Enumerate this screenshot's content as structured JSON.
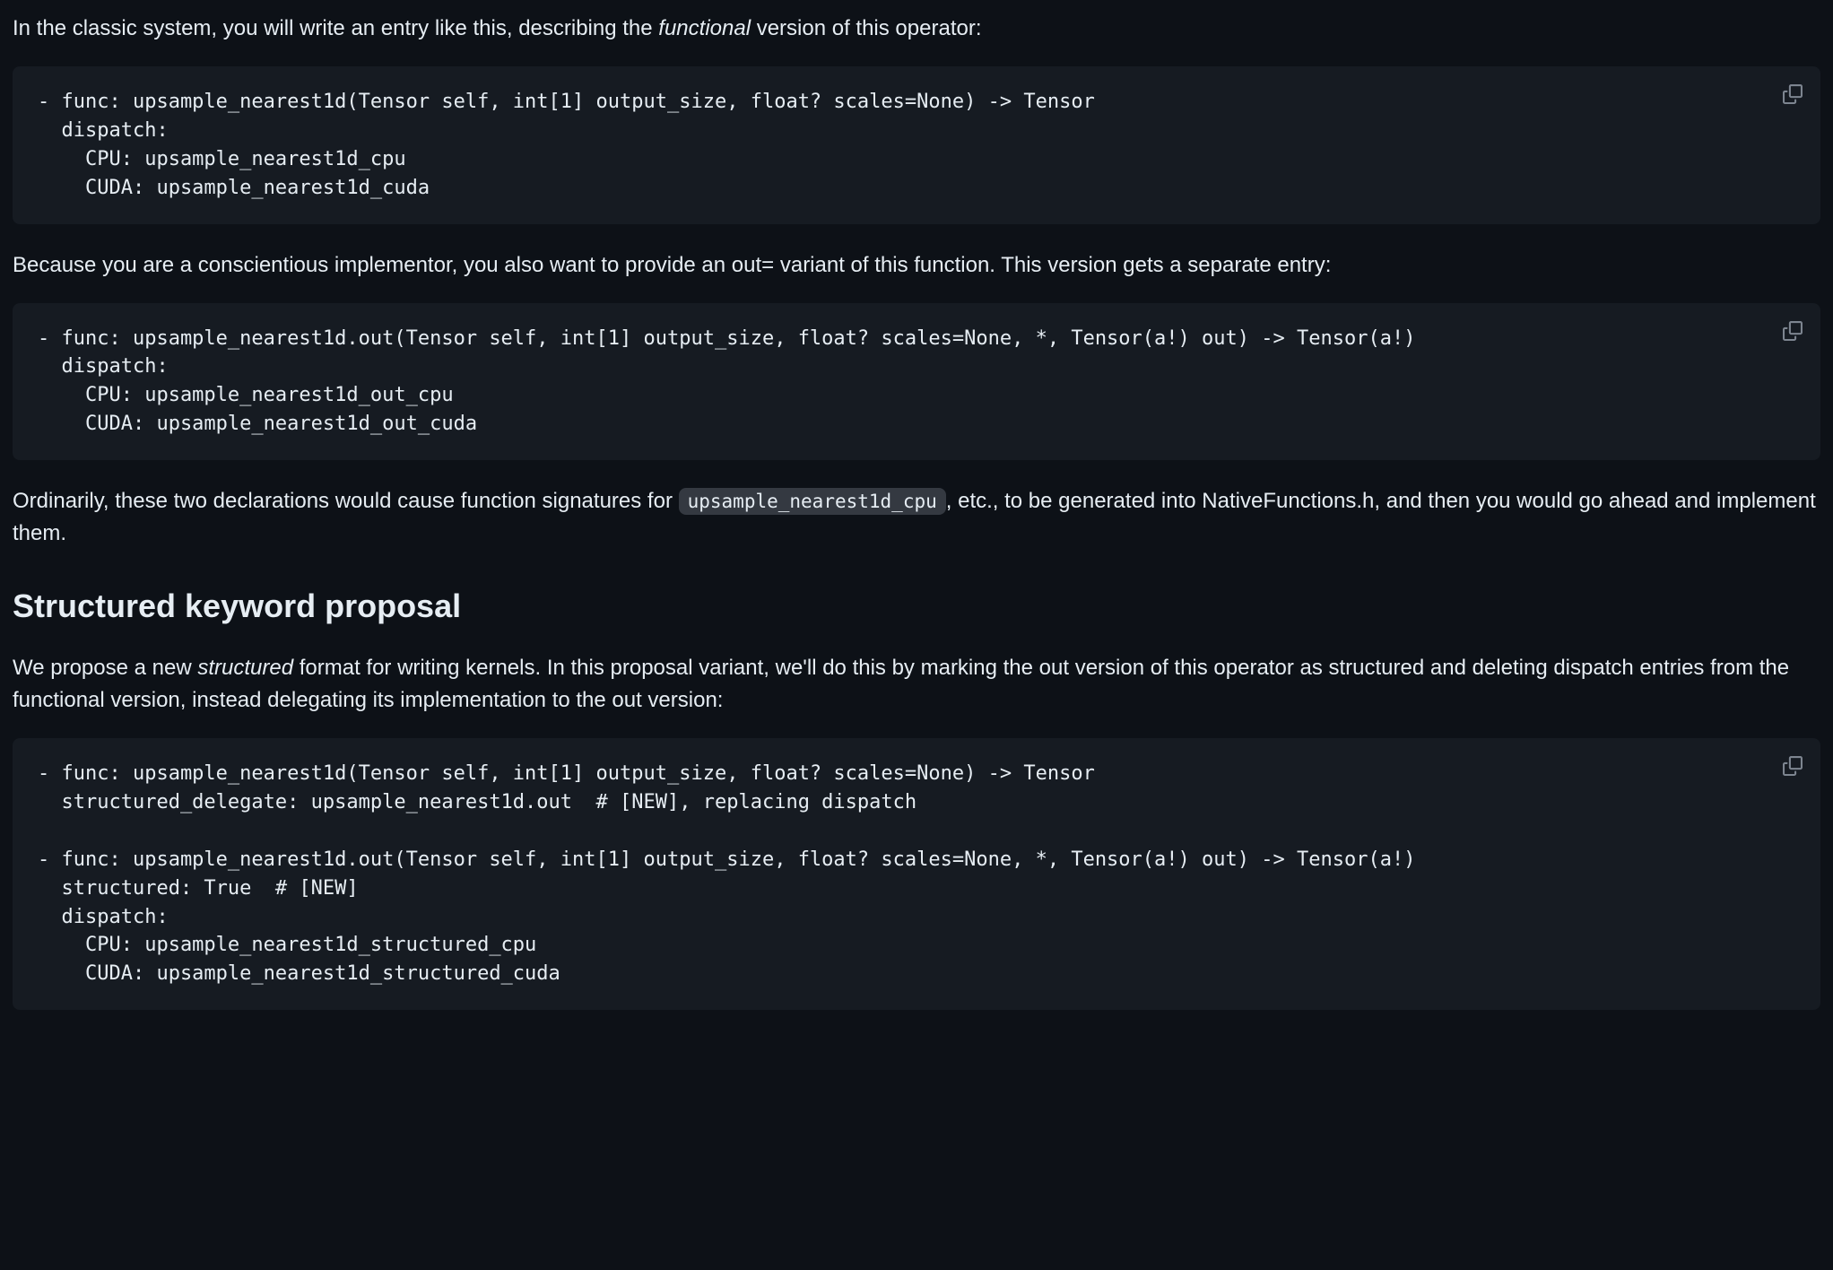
{
  "para1": {
    "pre": "In the classic system, you will write an entry like this, describing the ",
    "em": "functional",
    "post": " version of this operator:"
  },
  "code1": "- func: upsample_nearest1d(Tensor self, int[1] output_size, float? scales=None) -> Tensor\n  dispatch:\n    CPU: upsample_nearest1d_cpu\n    CUDA: upsample_nearest1d_cuda",
  "para2": "Because you are a conscientious implementor, you also want to provide an out= variant of this function. This version gets a separate entry:",
  "code2": "- func: upsample_nearest1d.out(Tensor self, int[1] output_size, float? scales=None, *, Tensor(a!) out) -> Tensor(a!)\n  dispatch:\n    CPU: upsample_nearest1d_out_cpu\n    CUDA: upsample_nearest1d_out_cuda",
  "para3": {
    "pre": "Ordinarily, these two declarations would cause function signatures for ",
    "code": "upsample_nearest1d_cpu",
    "post": ", etc., to be generated into NativeFunctions.h, and then you would go ahead and implement them."
  },
  "heading": "Structured keyword proposal",
  "para4": {
    "pre": "We propose a new ",
    "em": "structured",
    "post": " format for writing kernels. In this proposal variant, we'll do this by marking the out version of this operator as structured and deleting dispatch entries from the functional version, instead delegating its implementation to the out version:"
  },
  "code3": "- func: upsample_nearest1d(Tensor self, int[1] output_size, float? scales=None) -> Tensor\n  structured_delegate: upsample_nearest1d.out  # [NEW], replacing dispatch\n\n- func: upsample_nearest1d.out(Tensor self, int[1] output_size, float? scales=None, *, Tensor(a!) out) -> Tensor(a!)\n  structured: True  # [NEW]\n  dispatch:\n    CPU: upsample_nearest1d_structured_cpu\n    CUDA: upsample_nearest1d_structured_cuda"
}
